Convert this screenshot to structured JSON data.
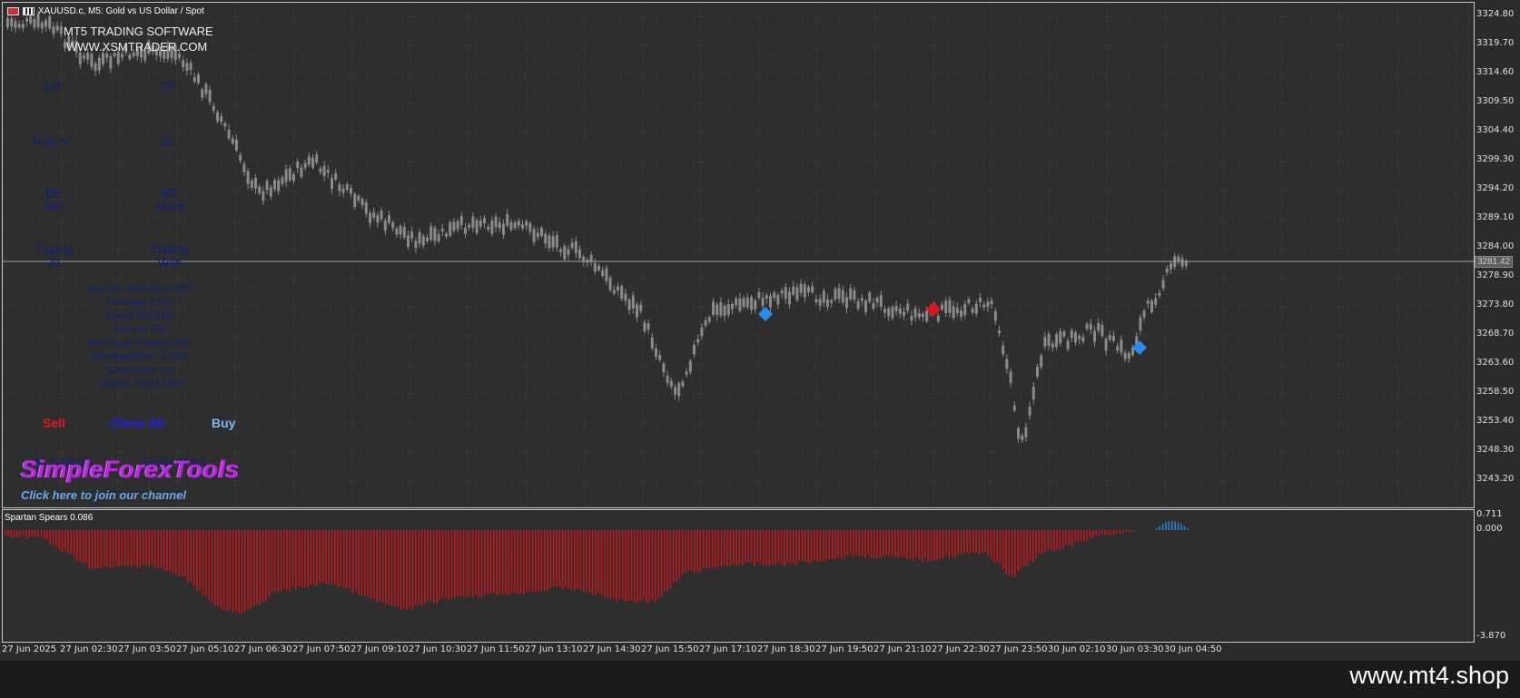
{
  "window": {
    "title": "XAUUSD.c, M5:  Gold vs US Dollar / Spot"
  },
  "software": {
    "line1": "MT5 TRADING SOFTWARE",
    "line2": "WWW.XSMTRADER.COM"
  },
  "panel": {
    "lot_label": "Lot",
    "tp_label": "TP",
    "risk_label": "Risk %",
    "sl_label": "SL",
    "be_set_label": "BE Set",
    "be_move_label": "BE Move",
    "trailing_at_label": "Trailing At",
    "trailing_with_label": "Trailing With",
    "account": [
      "Account: RoboForex-ECN",
      "Leverage: 1:500",
      "Equity: 639 USD",
      "Max Lot: 500",
      "Max Open Positions: 500",
      "Max drawdown: -1.24%",
      "Earned pips: 0.0",
      "Deposit: 10037 USD"
    ],
    "sell_label": "Sell",
    "close_all_label": "Close All",
    "buy_label": "Buy",
    "all_symbols_label": "All symbols",
    "order_count_label": "Order count"
  },
  "brand": {
    "name": "SimpleForexTools",
    "join_text": "Click here to join our channel"
  },
  "price_axis": [
    "3324.80",
    "3319.70",
    "3314.60",
    "3309.50",
    "3304.40",
    "3299.30",
    "3294.20",
    "3289.10",
    "3284.00",
    "3278.90",
    "3273.80",
    "3268.70",
    "3263.60",
    "3258.50",
    "3253.40",
    "3248.30",
    "3243.20"
  ],
  "current_price": "3281.42",
  "indicator": {
    "title": "Spartan Spears 0.086",
    "axis": [
      "0.711",
      "0.000",
      "-3.870"
    ]
  },
  "time_axis": [
    "27 Jun 2025",
    "27 Jun 02:30",
    "27 Jun 03:50",
    "27 Jun 05:10",
    "27 Jun 06:30",
    "27 Jun 07:50",
    "27 Jun 09:10",
    "27 Jun 10:30",
    "27 Jun 11:50",
    "27 Jun 13:10",
    "27 Jun 14:30",
    "27 Jun 15:50",
    "27 Jun 17:10",
    "27 Jun 18:30",
    "27 Jun 19:50",
    "27 Jun 21:10",
    "27 Jun 22:30",
    "27 Jun 23:50",
    "30 Jun 02:10",
    "30 Jun 03:30",
    "30 Jun 04:50"
  ],
  "colors": {
    "bull_marker": "#2a8cf0",
    "bear_marker": "#e0141e",
    "histogram_neg": "#c0181c",
    "histogram_pos": "#2a7fd0",
    "candle": "#8a8a8a"
  },
  "footer": {
    "watermark": "www.mt4.shop"
  }
}
